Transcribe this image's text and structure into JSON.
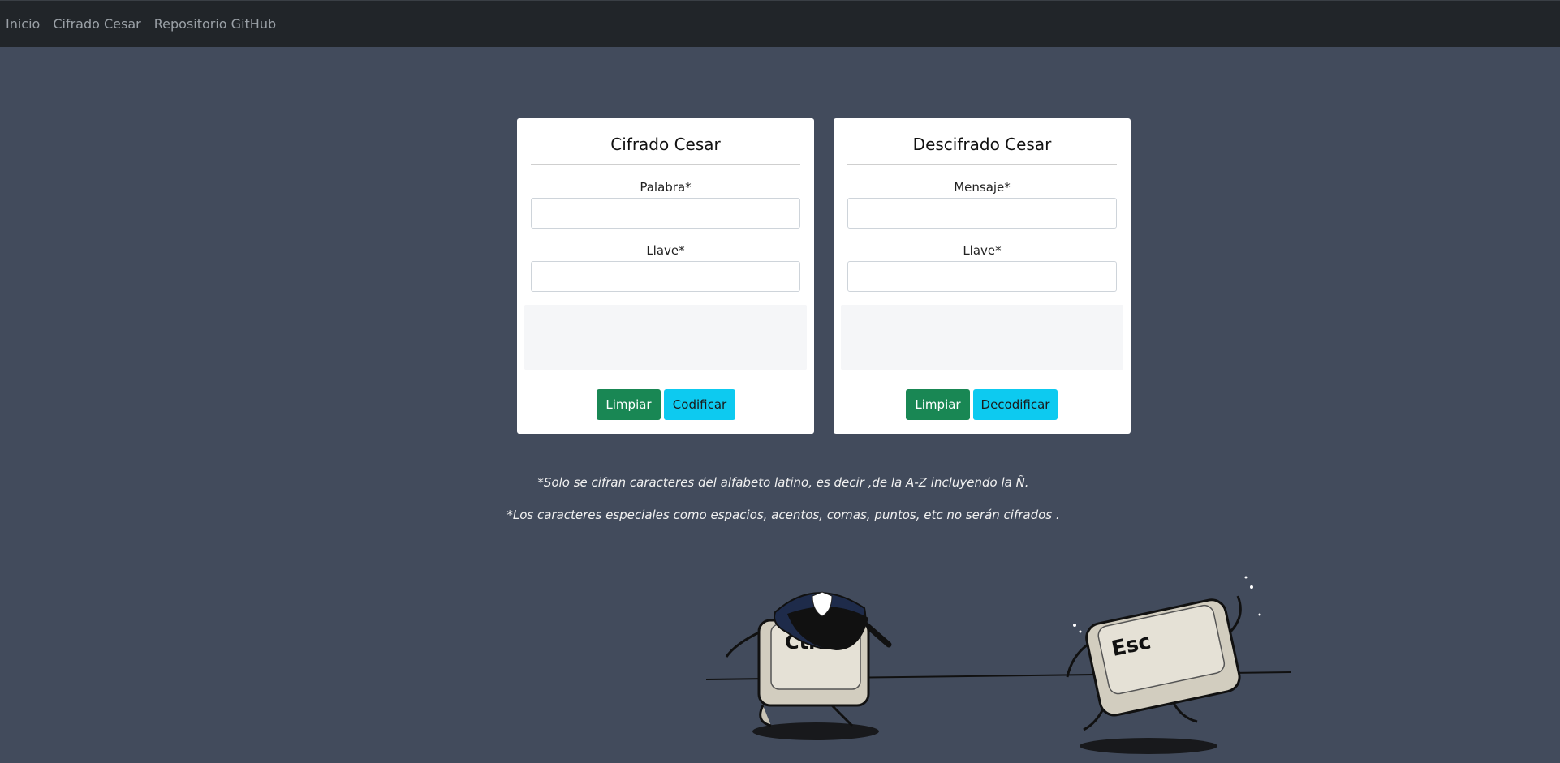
{
  "nav": {
    "items": [
      {
        "label": "Inicio"
      },
      {
        "label": "Cifrado Cesar"
      },
      {
        "label": "Repositorio GitHub"
      }
    ]
  },
  "cifrado": {
    "title": "Cifrado Cesar",
    "field1_label": "Palabra*",
    "field1_value": "",
    "field2_label": "Llave*",
    "field2_value": "",
    "result": "",
    "clear_label": "Limpiar",
    "action_label": "Codificar"
  },
  "descifrado": {
    "title": "Descifrado Cesar",
    "field1_label": "Mensaje*",
    "field1_value": "",
    "field2_label": "Llave*",
    "field2_value": "",
    "result": "",
    "clear_label": "Limpiar",
    "action_label": "Decodificar"
  },
  "notes": {
    "line1": "*Solo se cifran caracteres del alfabeto latino, es decir ,de la A-Z incluyendo la Ñ.",
    "line2": "*Los caracteres especiales como espacios, acentos, comas, puntos, etc no serán cifrados ."
  },
  "illustration": {
    "ctrl_key": "Ctrl",
    "esc_key": "Esc"
  },
  "colors": {
    "background": "#424b5c",
    "navbar": "#212529",
    "btn_green": "#198754",
    "btn_cyan": "#0dcaf0"
  }
}
